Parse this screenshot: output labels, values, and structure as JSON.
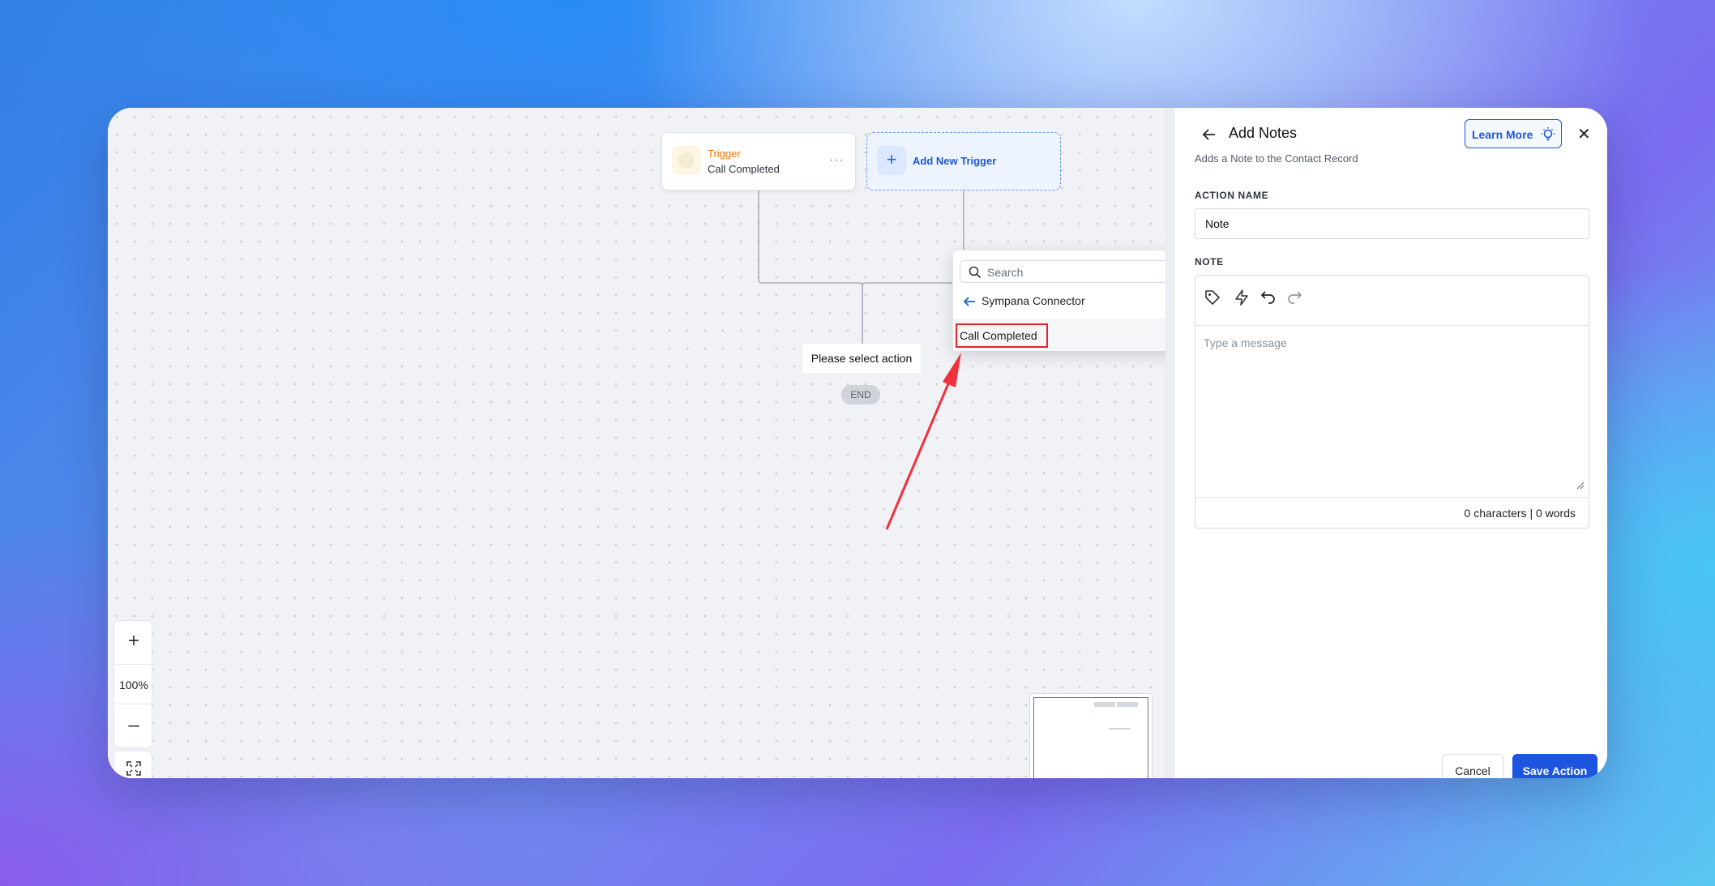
{
  "canvas": {
    "trigger": {
      "label": "Trigger",
      "sub": "Call Completed",
      "more": "···"
    },
    "add_trigger": {
      "plus": "+",
      "label": "Add New Trigger"
    },
    "select_action": "Please select action",
    "end": "END",
    "zoom": {
      "plus": "+",
      "level": "100%",
      "minus": "–"
    }
  },
  "dropdown": {
    "search_placeholder": "Search",
    "back_label": "Sympana Connector",
    "item_label": "Call Completed"
  },
  "panel": {
    "title": "Add Notes",
    "subtitle": "Adds a Note to the Contact Record",
    "learn_more": "Learn More",
    "close": "✕",
    "action_name_label": "ACTION NAME",
    "action_name_value": "Note",
    "note_label": "NOTE",
    "note_placeholder": "Type a message",
    "counter": "0 characters | 0 words",
    "cancel": "Cancel",
    "save": "Save Action"
  },
  "colors": {
    "accent": "#1d54e0",
    "trigger": "#e8750f",
    "highlight": "#e0242c"
  },
  "icons": [
    "search-icon",
    "arrow-left-icon",
    "chevron-right-icon",
    "tag-icon",
    "bolt-icon",
    "undo-icon",
    "redo-icon",
    "lightbulb-icon",
    "close-icon",
    "fit-view-icon"
  ]
}
